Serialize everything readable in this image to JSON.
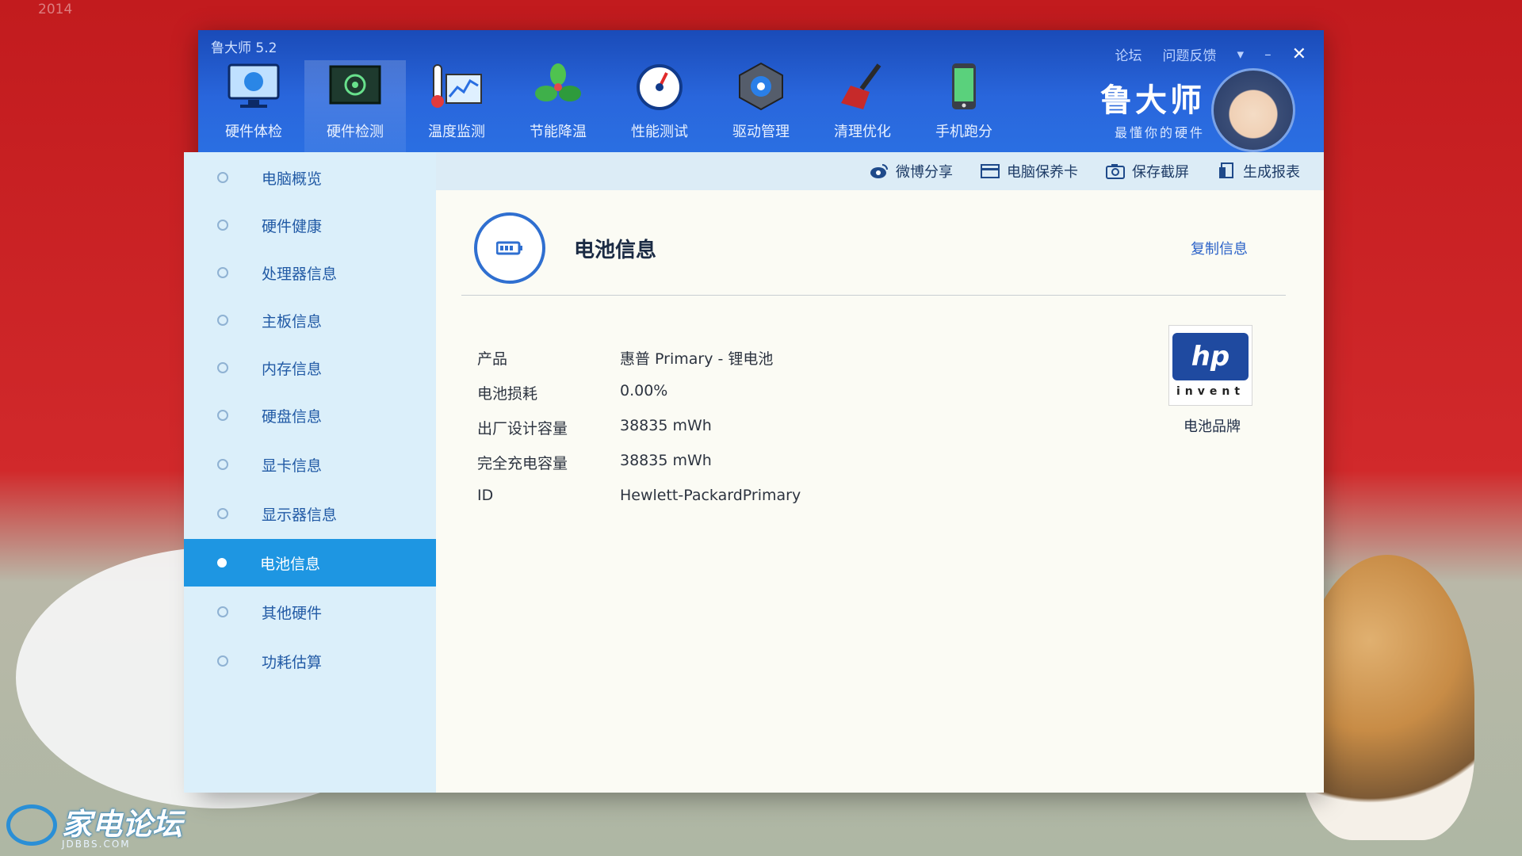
{
  "background": {
    "year": "2014"
  },
  "forum": {
    "name": "家电论坛",
    "domain": "JDBBS.COM"
  },
  "window": {
    "title": "鲁大师 5.2",
    "controls": {
      "forum": "论坛",
      "feedback": "问题反馈",
      "menu": "▾",
      "minimize": "–",
      "close": "✕"
    }
  },
  "brand": {
    "name": "鲁大师",
    "slogan": "最懂你的硬件"
  },
  "toolbar": {
    "items": [
      {
        "label": "硬件体检",
        "icon": "monitor-check-icon"
      },
      {
        "label": "硬件检测",
        "icon": "circuit-board-icon",
        "active": true
      },
      {
        "label": "温度监测",
        "icon": "thermometer-chart-icon"
      },
      {
        "label": "节能降温",
        "icon": "fan-icon"
      },
      {
        "label": "性能测试",
        "icon": "speedometer-icon"
      },
      {
        "label": "驱动管理",
        "icon": "gear-hex-icon"
      },
      {
        "label": "清理优化",
        "icon": "broom-icon"
      },
      {
        "label": "手机跑分",
        "icon": "phone-icon"
      }
    ]
  },
  "sidebar": {
    "items": [
      {
        "label": "电脑概览"
      },
      {
        "label": "硬件健康"
      },
      {
        "label": "处理器信息"
      },
      {
        "label": "主板信息"
      },
      {
        "label": "内存信息"
      },
      {
        "label": "硬盘信息"
      },
      {
        "label": "显卡信息"
      },
      {
        "label": "显示器信息"
      },
      {
        "label": "电池信息",
        "active": true
      },
      {
        "label": "其他硬件"
      },
      {
        "label": "功耗估算"
      }
    ]
  },
  "actions": {
    "weibo_share": "微博分享",
    "maintenance_card": "电脑保养卡",
    "save_screenshot": "保存截屏",
    "generate_report": "生成报表"
  },
  "section": {
    "title": "电池信息",
    "copy_label": "复制信息",
    "rows": [
      {
        "key": "产品",
        "value": "惠普 Primary -   锂电池"
      },
      {
        "key": "电池损耗",
        "value": "0.00%"
      },
      {
        "key": "出厂设计容量",
        "value": "38835 mWh"
      },
      {
        "key": "完全充电容量",
        "value": "38835 mWh"
      },
      {
        "key": "ID",
        "value": "Hewlett-PackardPrimary"
      }
    ],
    "brand_logo": {
      "mark": "hp",
      "tagline": "invent"
    },
    "brand_label": "电池品牌"
  }
}
